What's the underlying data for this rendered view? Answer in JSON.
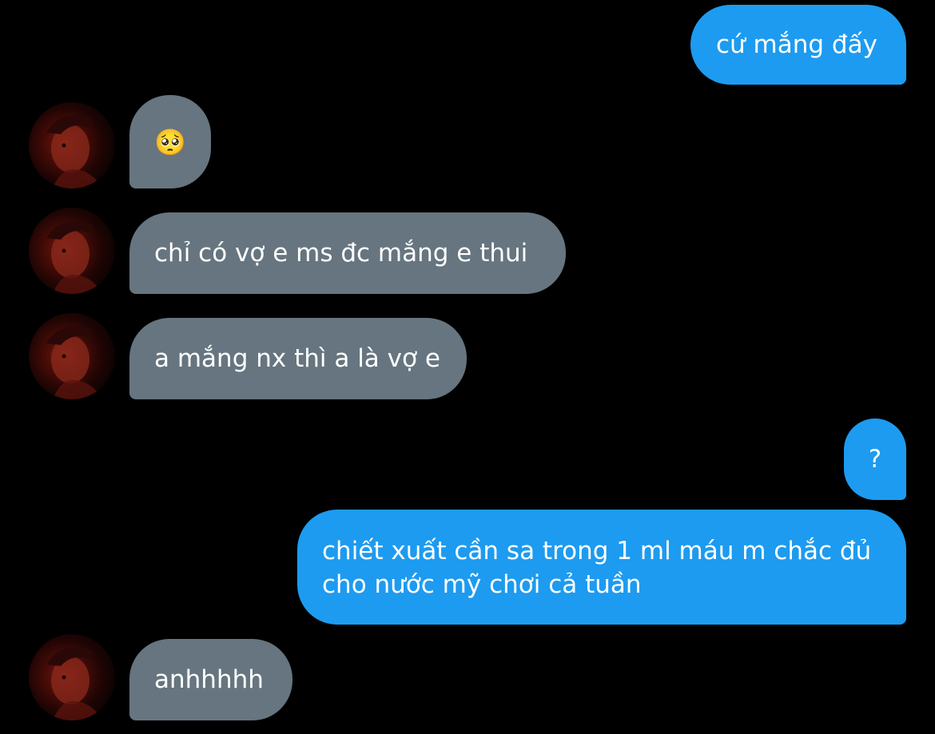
{
  "conversation": {
    "messages": [
      {
        "sender": "me",
        "text": "cứ mắng đấy"
      },
      {
        "sender": "them",
        "text": "🥺"
      },
      {
        "sender": "them",
        "text": "chỉ có vợ e ms đc mắng e thui"
      },
      {
        "sender": "them",
        "text": "a mắng nx thì a là vợ e"
      },
      {
        "sender": "me",
        "text": "?"
      },
      {
        "sender": "me",
        "text": "chiết xuất cần sa trong 1 ml máu m chắc đủ cho nước mỹ chơi cả tuần"
      },
      {
        "sender": "them",
        "text": "anhhhhh"
      }
    ]
  },
  "colors": {
    "background": "#000000",
    "sent_bubble": "#1d9bf0",
    "received_bubble": "#66757f",
    "text": "#ffffff"
  },
  "icons": {
    "avatar": "contact-avatar"
  }
}
